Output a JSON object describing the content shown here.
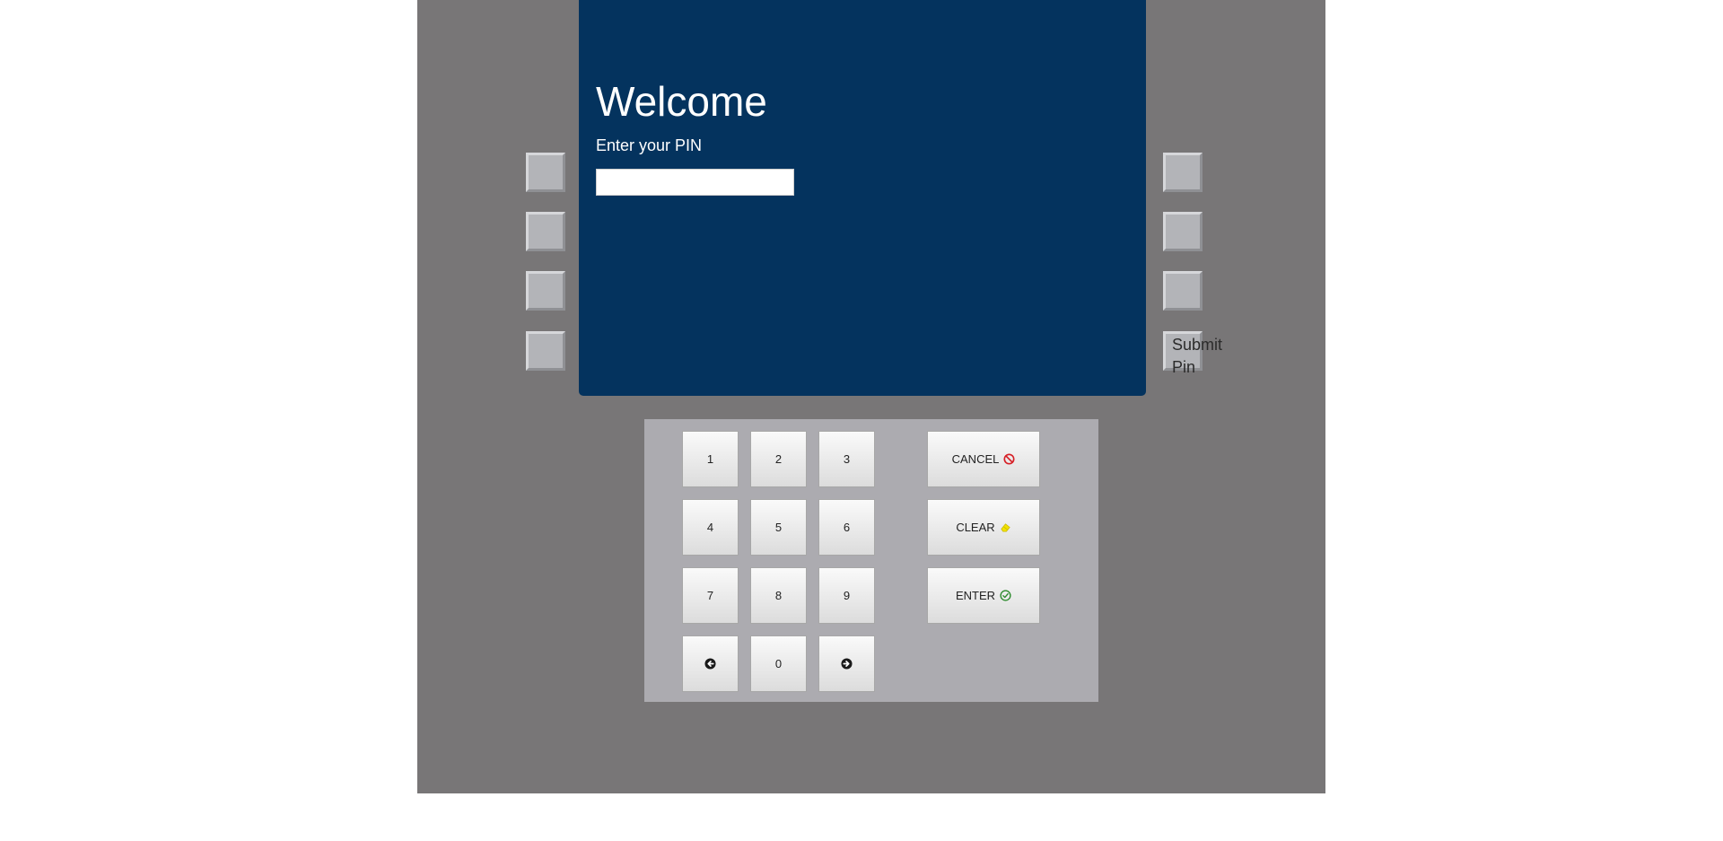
{
  "screen": {
    "title": "Welcome",
    "prompt": "Enter your PIN",
    "pin_value": "",
    "pin_placeholder": "",
    "background_color": "#04335e"
  },
  "side_buttons": {
    "right_bottom_label": "Submit Pin"
  },
  "keypad": {
    "digits": [
      "1",
      "2",
      "3",
      "4",
      "5",
      "6",
      "7",
      "8",
      "9",
      "0"
    ],
    "prev_icon": "arrow-left-circle-icon",
    "next_icon": "arrow-right-circle-icon",
    "cancel_label": "CANCEL",
    "cancel_icon": "no-entry-icon",
    "cancel_icon_color": "#d61f26",
    "clear_label": "CLEAR",
    "clear_icon": "eraser-icon",
    "clear_icon_color": "#f2e200",
    "enter_label": "ENTER",
    "enter_icon": "check-circle-icon",
    "enter_icon_color": "#2e8b2e"
  },
  "colors": {
    "atm_body": "#787677",
    "keypad_panel": "#acabb0"
  }
}
